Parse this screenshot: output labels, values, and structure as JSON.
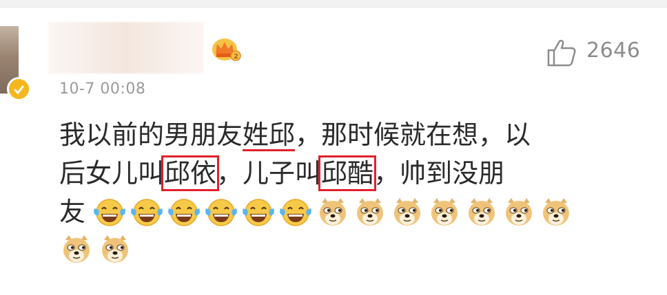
{
  "comment": {
    "timestamp": "10-7 00:08",
    "likes": "2646",
    "text": {
      "l1_a": "我以前的",
      "l1_b": "男朋友",
      "l1_c": "姓邱",
      "l1_d": "，那时候就在想，以",
      "l2_a": "后女儿叫",
      "l2_b": "邱依",
      "l2_c": "，儿子叫",
      "l2_d": "邱酷",
      "l2_e": "，帅到没朋",
      "l3_a": "友"
    },
    "emojis": [
      "laugh-cry-icon",
      "laugh-cry-icon",
      "laugh-cry-icon",
      "laugh-cry-icon",
      "laugh-cry-icon",
      "laugh-cry-icon",
      "doge-icon",
      "doge-icon",
      "doge-icon",
      "doge-icon",
      "doge-icon",
      "doge-icon",
      "doge-icon",
      "doge-icon",
      "doge-icon"
    ]
  },
  "colors": {
    "highlight": "#e0202a",
    "meta": "#9a9a9a",
    "badge": "#f5b71d"
  }
}
